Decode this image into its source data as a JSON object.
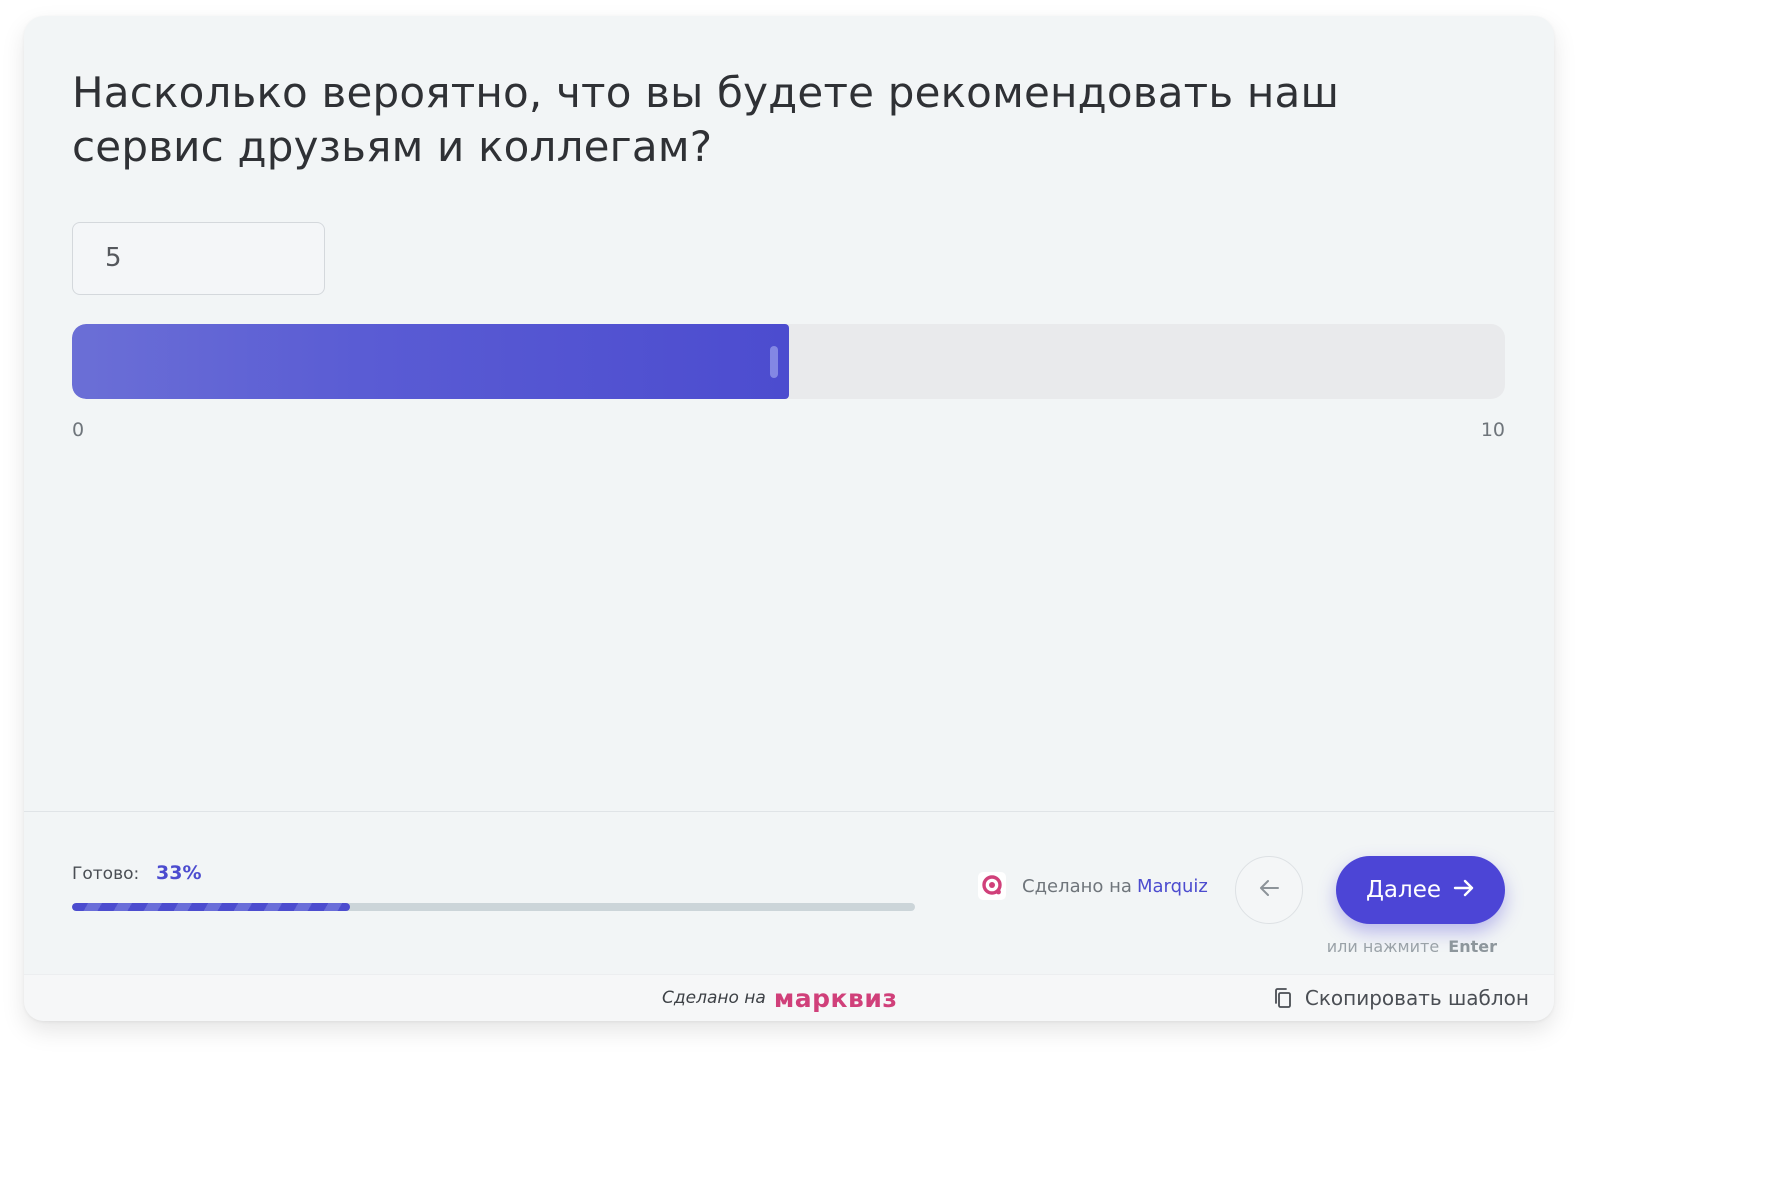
{
  "question": {
    "title": "Насколько вероятно, что вы будете рекомендовать наш сервис друзьям и коллегам?"
  },
  "slider": {
    "value": "5",
    "min_label": "0",
    "max_label": "10",
    "min": 0,
    "max": 10,
    "current": 5,
    "fill_color": "#4c4ccf"
  },
  "progress": {
    "label": "Готово:",
    "value_label": "33%",
    "fraction": 0.33
  },
  "branding": {
    "made_on_text": "Сделано на",
    "made_on_link": "Marquiz",
    "logo_icon": "marquiz-logo-icon"
  },
  "navigation": {
    "back_icon": "arrow-left-icon",
    "next_label": "Далее",
    "next_icon": "arrow-right-icon",
    "hint_text": "или нажмите",
    "hint_key": "Enter"
  },
  "footer": {
    "made_on_text": "Сделано на",
    "brand_name": "марквиз",
    "copy_label": "Скопировать шаблон",
    "copy_icon": "copy-icon"
  },
  "colors": {
    "accent": "#4c45d6",
    "brand_pink": "#d0407a",
    "card_background": "#f2f5f6"
  }
}
